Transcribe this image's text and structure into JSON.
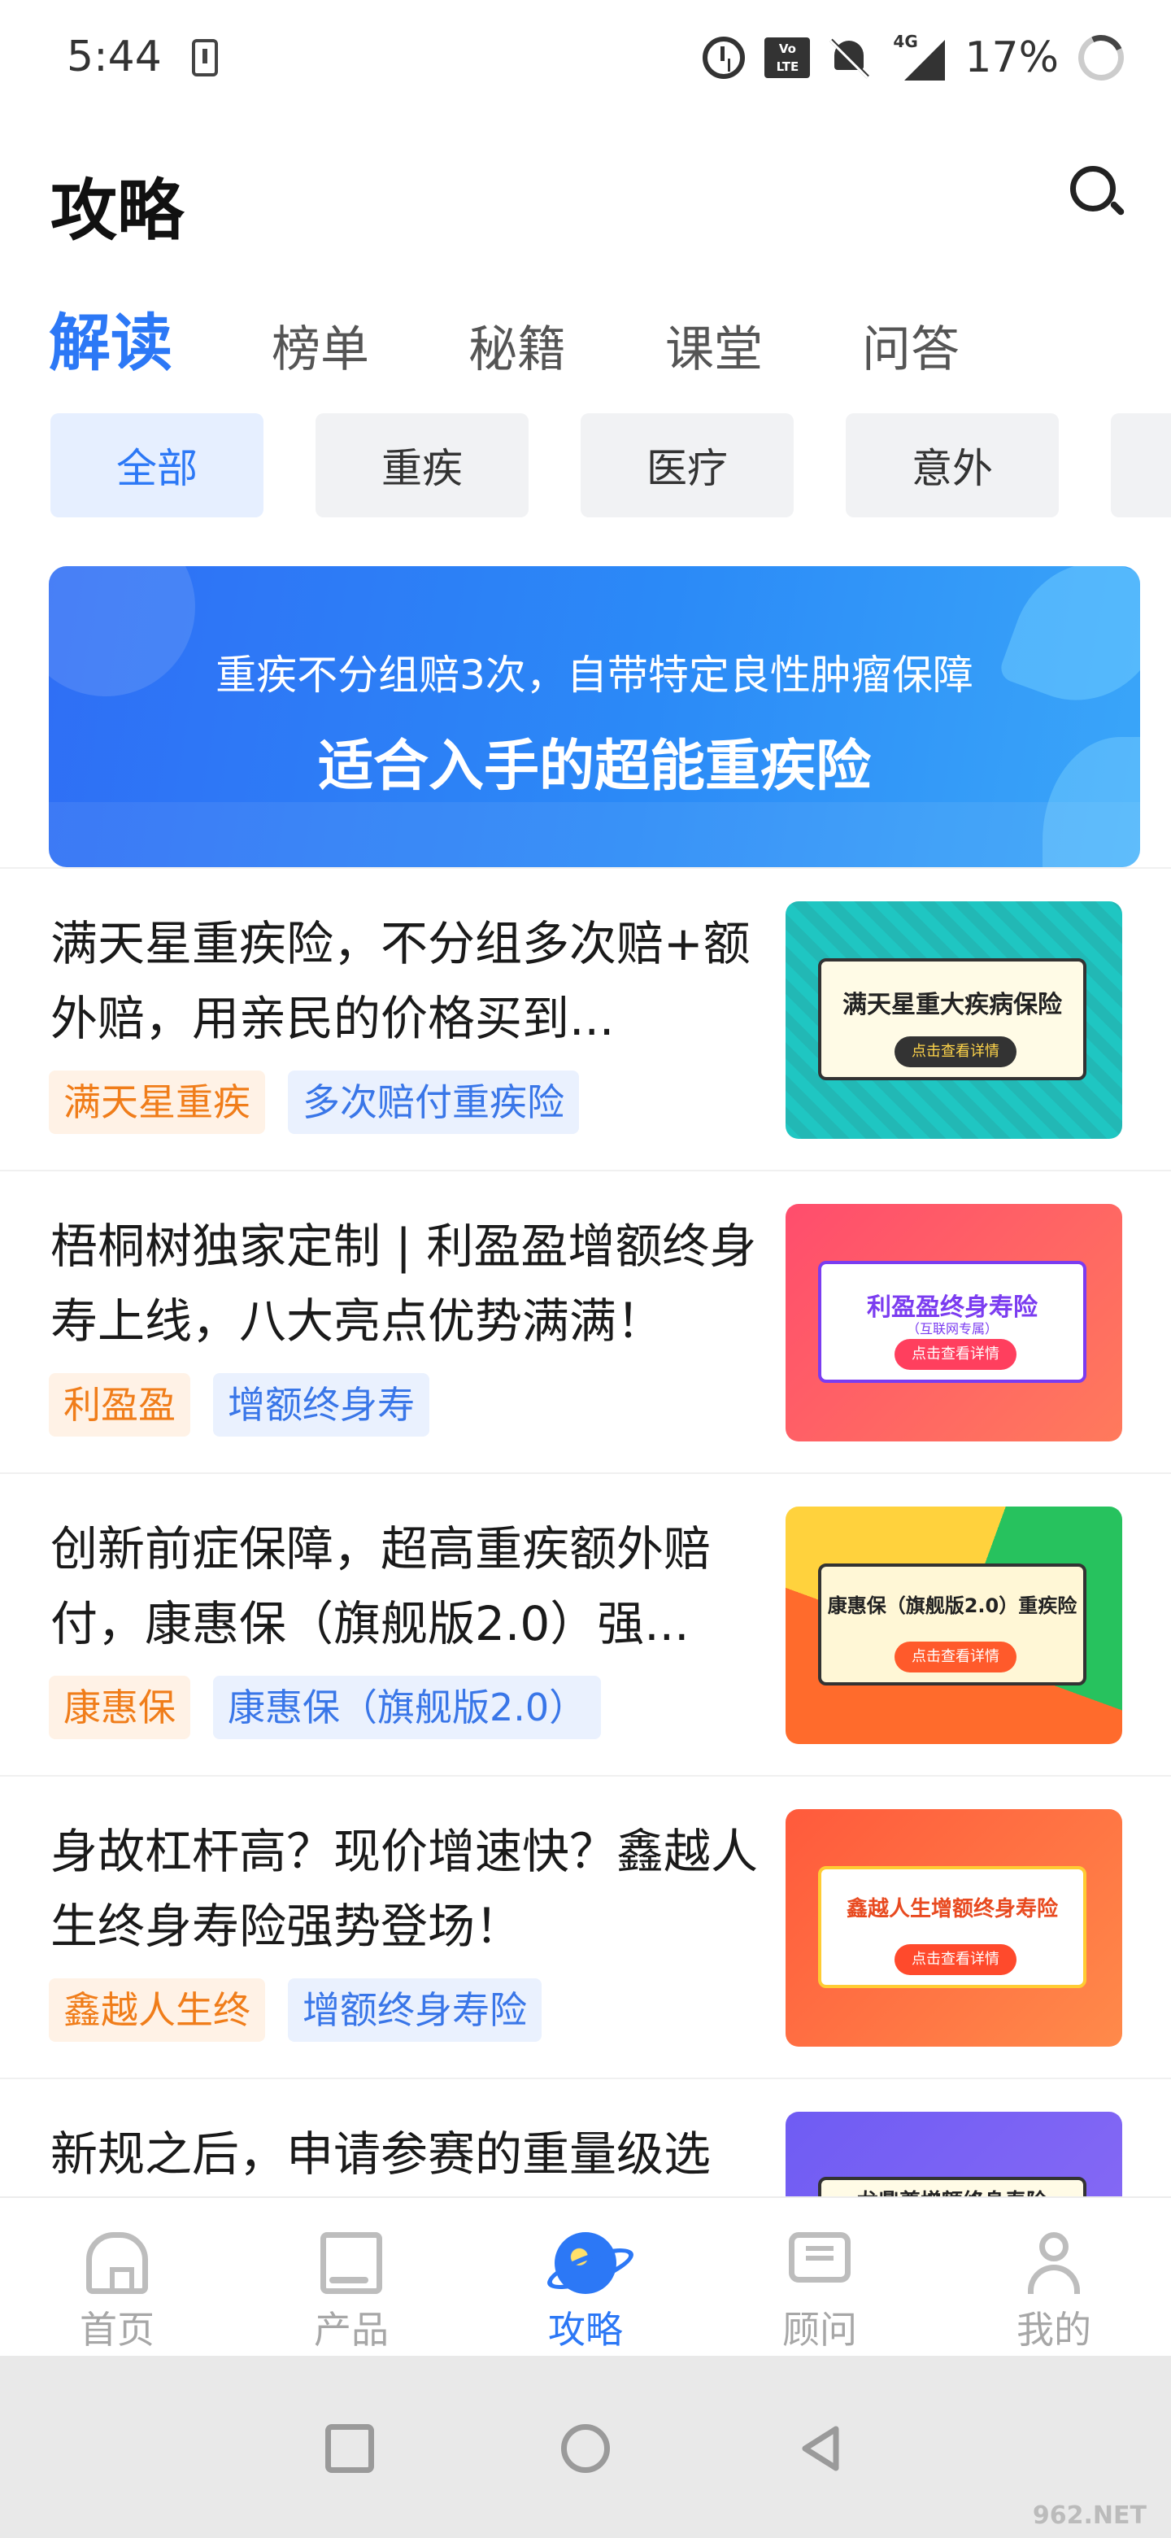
{
  "status_bar": {
    "time": "5:44",
    "network": "4G",
    "battery": "17%"
  },
  "header": {
    "title": "攻略"
  },
  "tabs": [
    "解读",
    "榜单",
    "秘籍",
    "课堂",
    "问答"
  ],
  "chips": [
    "全部",
    "重疾",
    "医疗",
    "意外"
  ],
  "banner": {
    "subtitle": "重疾不分组赔3次，自带特定良性肿瘤保障",
    "title": "适合入手的超能重疾险"
  },
  "articles": [
    {
      "title": "满天星重疾险，不分组多次赔+额外赔，用亲民的价格买到...",
      "tags": [
        "满天星重疾",
        "多次赔付重疾险"
      ],
      "thumb": {
        "title": "满天星重大疾病保险",
        "button": "点击查看详情"
      }
    },
    {
      "title": "梧桐树独家定制 | 利盈盈增额终身寿上线，八大亮点优势满满！",
      "tags": [
        "利盈盈",
        "增额终身寿"
      ],
      "thumb": {
        "title": "利盈盈终身寿险",
        "subtitle": "（互联网专属）",
        "button": "点击查看详情"
      }
    },
    {
      "title": "创新前症保障，超高重疾额外赔付，康惠保（旗舰版2.0）强...",
      "tags": [
        "康惠保",
        "康惠保（旗舰版2.0）"
      ],
      "thumb": {
        "title": "康惠保（旗舰版2.0）重疾险",
        "button": "点击查看详情"
      }
    },
    {
      "title": "身故杠杆高？现价增速快？鑫越人生终身寿险强势登场！",
      "tags": [
        "鑫越人生终",
        "增额终身寿险"
      ],
      "thumb": {
        "title": "鑫越人生增额终身寿险",
        "button": "点击查看详情"
      }
    },
    {
      "title": "新规之后，申请参赛的重量级选",
      "thumb": {
        "title": "龙鼎尊增额终身寿险"
      }
    }
  ],
  "bottom_nav": [
    {
      "label": "首页",
      "icon": "home-icon"
    },
    {
      "label": "产品",
      "icon": "product-book-icon"
    },
    {
      "label": "攻略",
      "icon": "planet-icon"
    },
    {
      "label": "顾问",
      "icon": "chat-icon"
    },
    {
      "label": "我的",
      "icon": "user-icon"
    }
  ],
  "active_nav": "攻略",
  "watermark": "962.NET",
  "colors": {
    "accent": "#2c78f6",
    "tag_orange": "#f07d1a",
    "tag_blue": "#3976e8"
  }
}
